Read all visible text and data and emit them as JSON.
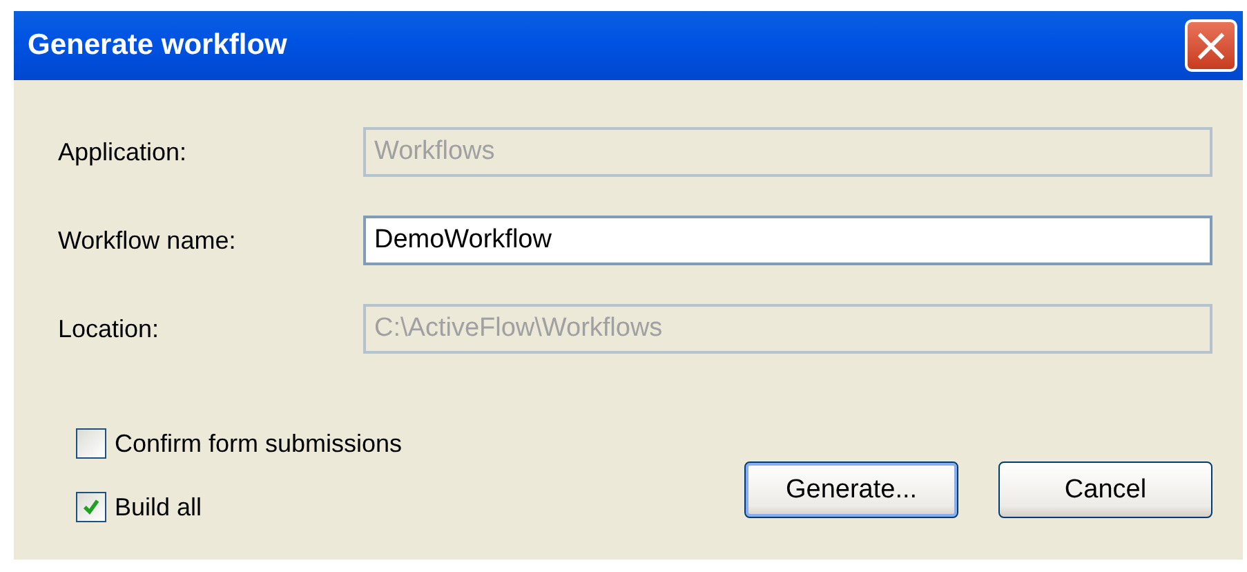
{
  "window": {
    "title": "Generate workflow",
    "close": "×"
  },
  "fields": [
    {
      "label": "Application:",
      "value": "Workflows",
      "disabled": true
    },
    {
      "label": "Workflow name:",
      "value": "DemoWorkflow",
      "disabled": false
    },
    {
      "label": "Location:",
      "value": "C:\\ActiveFlow\\Workflows",
      "disabled": true
    }
  ],
  "checkboxes": [
    {
      "label": "Confirm form submissions",
      "checked": false
    },
    {
      "label": "Build all",
      "checked": true
    }
  ],
  "buttons": [
    {
      "label": "Generate...",
      "default": true
    },
    {
      "label": "Cancel",
      "default": false
    }
  ]
}
